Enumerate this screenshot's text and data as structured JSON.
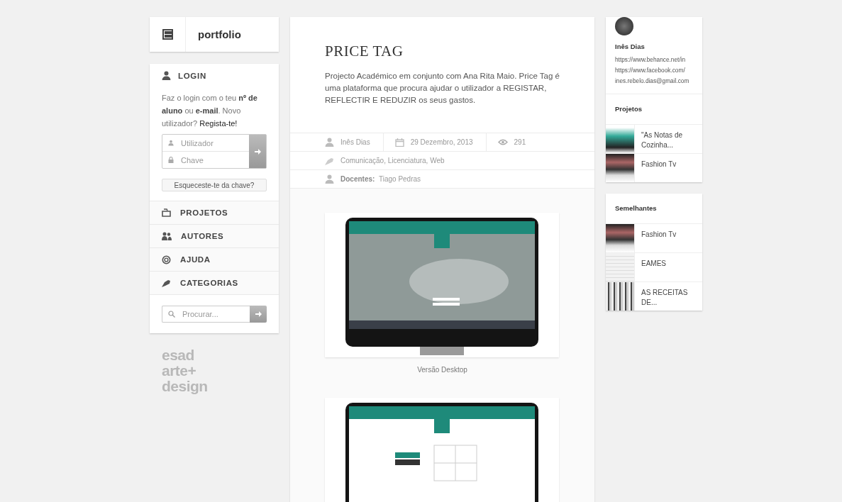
{
  "logo": {
    "text": "portfolio"
  },
  "login": {
    "title": "LOGIN",
    "text": "Faz o login com o teu **nº de aluno** ou **e-mail**. Novo utilizador? ",
    "link": "Regista-te!",
    "user_placeholder": "Utilizador",
    "key_placeholder": "Chave",
    "forgot": "Esqueceste-te da chave?"
  },
  "nav": [
    {
      "kind": "projects",
      "label": "PROJETOS"
    },
    {
      "kind": "authors",
      "label": "AUTORES"
    },
    {
      "kind": "help",
      "label": "AJUDA"
    },
    {
      "kind": "categories",
      "label": "CATEGORIAS"
    }
  ],
  "search": {
    "placeholder": "Procurar..."
  },
  "brand": [
    "esad",
    "arte+",
    "design"
  ],
  "project": {
    "title": "PRICE TAG",
    "description": "Projecto Académico em conjunto com Ana Rita Maio. Price Tag é uma plataforma que procura ajudar o utilizador a REGISTAR, REFLECTIR E REDUZIR os seus gastos.",
    "author": "Inês Dias",
    "date": "29 Dezembro, 2013",
    "views": "291",
    "categories": "Comunicação, Licenciatura, Web",
    "teachers_label": "Docentes:",
    "teachers": "Tiago Pedras",
    "images": [
      {
        "kind": "home",
        "caption": "Versão Desktop"
      },
      {
        "kind": "balance"
      }
    ]
  },
  "author": {
    "name": "Inês Dias",
    "links": [
      "https://www.behance.net/in",
      "https://www.facebook.com/",
      "ines.rebelo.dias@gmail.com"
    ]
  },
  "projects": {
    "title": "Projetos",
    "items": [
      {
        "kind": "chair",
        "title": "\"As Notas de Cozinha..."
      },
      {
        "kind": "screen",
        "title": "Fashion Tv"
      }
    ]
  },
  "similar": {
    "title": "Semelhantes",
    "items": [
      {
        "kind": "screen",
        "title": "Fashion Tv"
      },
      {
        "kind": "sketch",
        "title": "EAMES"
      },
      {
        "kind": "photo",
        "title": "AS RECEITAS DE..."
      }
    ]
  }
}
